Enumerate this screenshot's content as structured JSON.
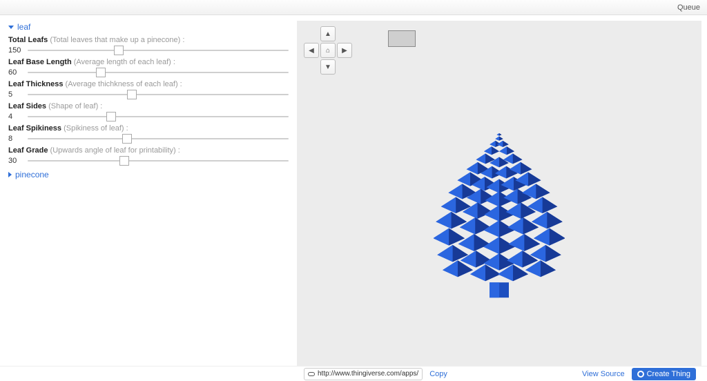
{
  "topbar": {
    "queue": "Queue"
  },
  "groups": {
    "leaf": {
      "title": "leaf",
      "expanded": true,
      "params": [
        {
          "name": "Total Leafs",
          "desc": "(Total leaves that make up a pinecone) :",
          "value": "150",
          "percent": 35
        },
        {
          "name": "Leaf Base Length",
          "desc": "(Average length of each leaf) :",
          "value": "60",
          "percent": 28
        },
        {
          "name": "Leaf Thickness",
          "desc": "(Average thichkness of each leaf) :",
          "value": "5",
          "percent": 40
        },
        {
          "name": "Leaf Sides",
          "desc": "(Shape of leaf) :",
          "value": "4",
          "percent": 32
        },
        {
          "name": "Leaf Spikiness",
          "desc": "(Spikiness of leaf) :",
          "value": "8",
          "percent": 38
        },
        {
          "name": "Leaf Grade",
          "desc": "(Upwards angle of leaf for printability) :",
          "value": "30",
          "percent": 37
        }
      ]
    },
    "pinecone": {
      "title": "pinecone",
      "expanded": false
    }
  },
  "bottom": {
    "url": "http://www.thingiverse.com/apps/",
    "copy": "Copy",
    "view_source": "View Source",
    "create": "Create Thing"
  }
}
